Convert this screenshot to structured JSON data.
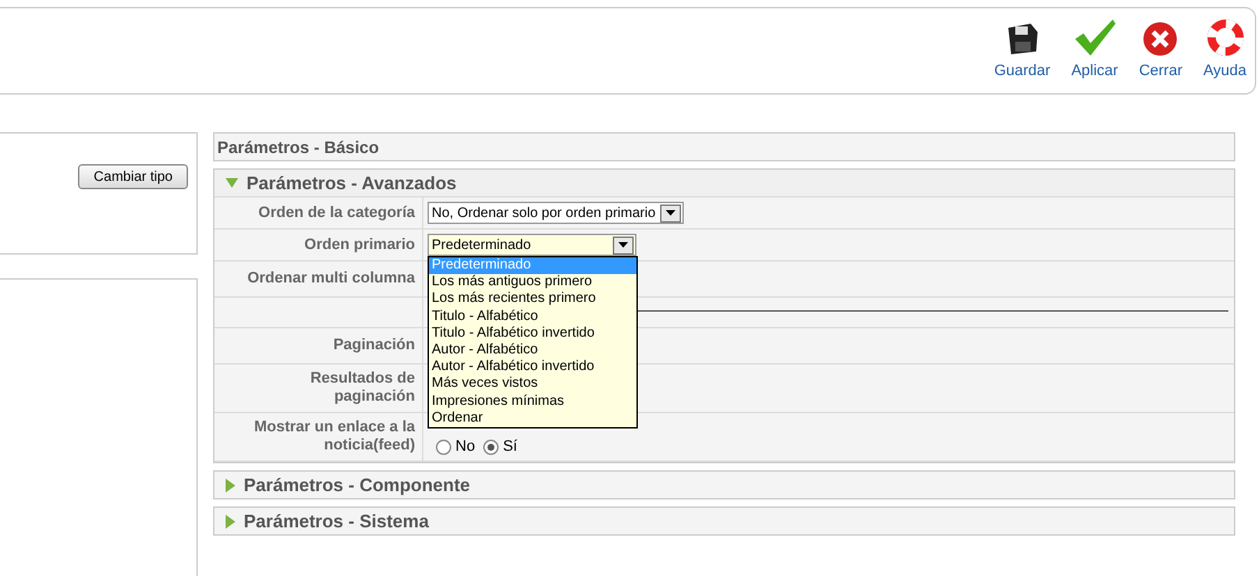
{
  "toolbar": [
    {
      "kind": "save",
      "label": "Guardar"
    },
    {
      "kind": "apply",
      "label": "Aplicar"
    },
    {
      "kind": "close",
      "label": "Cerrar"
    },
    {
      "kind": "help",
      "label": "Ayuda"
    }
  ],
  "left_panel": {
    "button": "Cambiar tipo"
  },
  "sections": [
    {
      "title": "Parámetros - Básico",
      "kind": "plain"
    },
    {
      "title": "Parámetros - Avanzados",
      "kind": "toggle",
      "expanded": true,
      "rows": [
        {
          "label": "Orden de la categoría",
          "kind": "select",
          "value": "No, Ordenar solo por orden primario"
        },
        {
          "label": "Orden primario",
          "kind": "dropdown",
          "value": "Predeterminado",
          "options": [
            {
              "label": "Predeterminado",
              "selected": true
            },
            {
              "label": "Los más antiguos primero",
              "selected": false
            },
            {
              "label": "Los más recientes primero",
              "selected": false
            },
            {
              "label": "Titulo - Alfabético",
              "selected": false
            },
            {
              "label": "Titulo - Alfabético invertido",
              "selected": false
            },
            {
              "label": "Autor - Alfabético",
              "selected": false
            },
            {
              "label": "Autor - Alfabético invertido",
              "selected": false
            },
            {
              "label": "Más veces vistos",
              "selected": false
            },
            {
              "label": "Impresiones mínimas",
              "selected": false
            },
            {
              "label": "Ordenar",
              "selected": false
            }
          ]
        },
        {
          "label": "Ordenar multi columna",
          "kind": "empty"
        },
        {
          "label": "",
          "kind": "rule"
        },
        {
          "label": "Paginación",
          "kind": "empty"
        },
        {
          "label": "Resultados de paginación",
          "kind": "empty"
        },
        {
          "label": "Mostrar un enlace a la noticia(feed)",
          "kind": "radio",
          "options": [
            {
              "label": "No",
              "selected": false
            },
            {
              "label": "Sí",
              "selected": true
            }
          ]
        }
      ]
    },
    {
      "title": "Parámetros - Componente",
      "kind": "toggle",
      "expanded": false
    },
    {
      "title": "Parámetros - Sistema",
      "kind": "toggle",
      "expanded": false
    }
  ]
}
